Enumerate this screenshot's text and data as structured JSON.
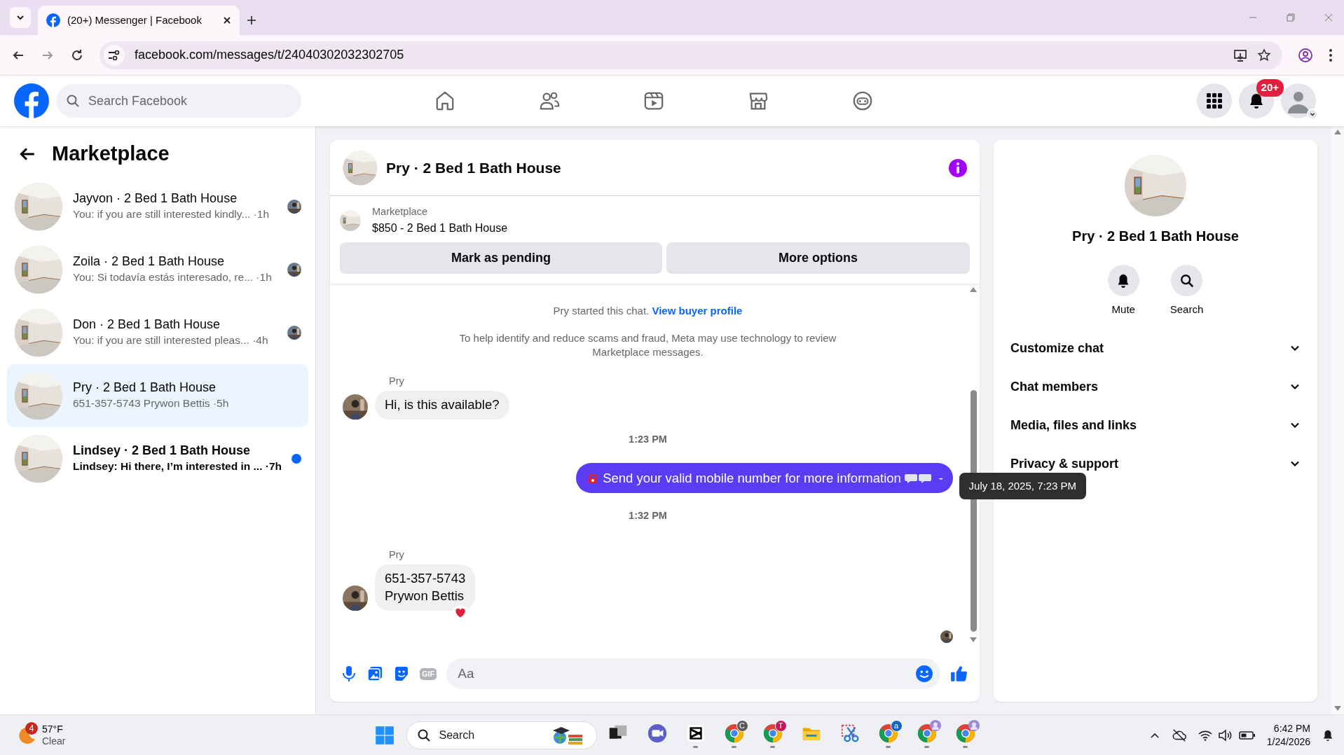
{
  "browser": {
    "tab_title": "(20+) Messenger | Facebook",
    "url": "facebook.com/messages/t/24040302032302705"
  },
  "header": {
    "search_placeholder": "Search Facebook",
    "notification_badge": "20+"
  },
  "sidebar": {
    "title": "Marketplace",
    "conversations": [
      {
        "name": "Jayvon · 2 Bed 1 Bath House",
        "preview": "You: if you are still interested kindly...",
        "time": "·1h",
        "selected": false,
        "unread": false,
        "seen": true
      },
      {
        "name": "Zoila · 2 Bed 1 Bath House",
        "preview": "You: Si todavía estás interesado, re...",
        "time": "·1h",
        "selected": false,
        "unread": false,
        "seen": true
      },
      {
        "name": "Don · 2 Bed 1 Bath House",
        "preview": "You: if you are still interested pleas...",
        "time": "·4h",
        "selected": false,
        "unread": false,
        "seen": true
      },
      {
        "name": "Pry · 2 Bed 1 Bath House",
        "preview": "651-357-5743 Prywon Bettis",
        "time": "·5h",
        "selected": true,
        "unread": false,
        "seen": false
      },
      {
        "name": "Lindsey · 2 Bed 1 Bath House",
        "preview": "Lindsey: Hi there, I’m interested in ...",
        "time": "·7h",
        "selected": false,
        "unread": true,
        "seen": false
      }
    ]
  },
  "chat": {
    "title": "Pry · 2 Bed 1 Bath House",
    "listing": {
      "label": "Marketplace",
      "title": "$850 - 2 Bed 1 Bath House"
    },
    "actions": [
      "Mark as pending",
      "More options"
    ],
    "notice": {
      "text": "Pry started this chat.",
      "link": "View buyer profile"
    },
    "disclaimer": "To help identify and reduce scams and fraud, Meta may use technology to review Marketplace messages.",
    "messages": [
      {
        "kind": "incoming",
        "sender": "Pry",
        "lines": [
          "Hi, is this available?"
        ],
        "reaction": false
      },
      {
        "kind": "time",
        "text": "1:23 PM"
      },
      {
        "kind": "outgoing",
        "text": "Send your valid mobile number for more information",
        "suffix": "-",
        "tooltip": "July 18, 2025, 7:23 PM"
      },
      {
        "kind": "time",
        "text": "1:32 PM"
      },
      {
        "kind": "incoming",
        "sender": "Pry",
        "lines": [
          "651-357-5743",
          "Prywon Bettis"
        ],
        "reaction": true
      }
    ],
    "composer": {
      "gif_label": "GIF",
      "placeholder": "Aa"
    }
  },
  "details": {
    "title": "Pry · 2 Bed 1 Bath House",
    "actions": [
      {
        "kind": "mute",
        "label": "Mute"
      },
      {
        "kind": "search",
        "label": "Search"
      }
    ],
    "sections": [
      {
        "label": "Customize chat",
        "expanded": false
      },
      {
        "label": "Chat members",
        "expanded": false
      },
      {
        "label": "Media, files and links",
        "expanded": false
      },
      {
        "label": "Privacy & support",
        "expanded": false
      }
    ]
  },
  "taskbar": {
    "temperature": "57°F",
    "condition": "Clear",
    "weather_badge": "4",
    "search_placeholder": "Search",
    "apps": [
      {
        "kind": "taskview",
        "running": false
      },
      {
        "kind": "meet",
        "running": false
      },
      {
        "kind": "capcut",
        "running": true
      },
      {
        "kind": "chrome",
        "badge": "C",
        "running": true
      },
      {
        "kind": "chrome",
        "badge": "T",
        "running": true
      },
      {
        "kind": "explorer",
        "running": false
      },
      {
        "kind": "snip",
        "running": false
      },
      {
        "kind": "chrome",
        "badge": "a",
        "running": true
      },
      {
        "kind": "chrome",
        "profile_badge": true,
        "running": true
      },
      {
        "kind": "chrome",
        "profile_badge": true,
        "running": true
      }
    ],
    "time": "6:42 PM",
    "date": "1/24/2026"
  }
}
